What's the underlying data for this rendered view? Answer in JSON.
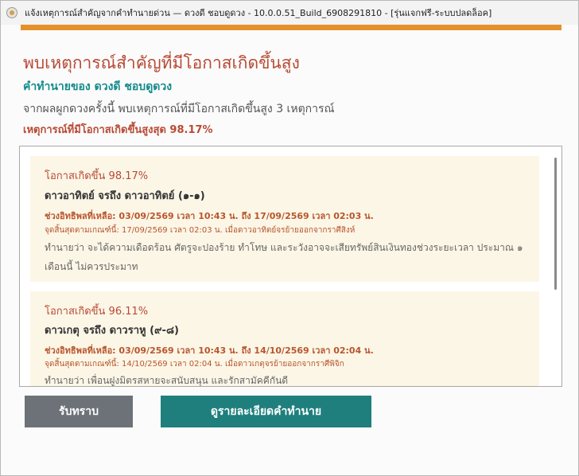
{
  "window": {
    "title": "แจ้งเหตุการณ์สำคัญจากคำทำนายด่วน — ดวงดี ชอบดูดวง - 10.0.0.51_Build_6908291810 - [รุ่นแจกฟรี-ระบบปลดล็อค]"
  },
  "header": {
    "heading": "พบเหตุการณ์สำคัญที่มีโอกาสเกิดขึ้นสูง",
    "subtitle": "คำทำนายของ ดวงดี ชอบดูดวง",
    "description": "จากผลผูกดวงครั้งนี้ พบเหตุการณ์ที่มีโอกาสเกิดขึ้นสูง 3 เหตุการณ์",
    "highest": "เหตุการณ์ที่มีโอกาสเกิดขึ้นสูงสุด 98.17%"
  },
  "events": [
    {
      "probability": "โอกาสเกิดขึ้น 98.17%",
      "planets": "ดาวอาทิตย์ จรถึง ดาวอาทิตย์ (๑-๑)",
      "period": "ช่วงอิทธิพลที่เหลือ: 03/09/2569 เวลา 10:43 น. ถึง 17/09/2569 เวลา 02:03 น.",
      "end_criteria": "จุดสิ้นสุดตามเกณฑ์นี้: 17/09/2569 เวลา 02:03 น. เมื่อดาวอาทิตย์จรย้ายออกจากราศีสิงห์",
      "prediction": "ทำนายว่า จะได้ความเดือดร้อน ศัตรูจะปองร้าย ทำโทษ และระวังอาจจะเสียทรัพย์สินเงินทองช่วงระยะเวลา ประมาณ ๑ เดือนนี้ ไม่ควรประมาท"
    },
    {
      "probability": "โอกาสเกิดขึ้น 96.11%",
      "planets": "ดาวเกตุ จรถึง ดาวราหู (๙-๘)",
      "period": "ช่วงอิทธิพลที่เหลือ: 03/09/2569 เวลา 10:43 น. ถึง 14/10/2569 เวลา 02:04 น.",
      "end_criteria": "จุดสิ้นสุดตามเกณฑ์นี้: 14/10/2569 เวลา 02:04 น. เมื่อดาวเกตุจรย้ายออกจากราศีพิจิก",
      "prediction": "ทำนายว่า เพื่อนฝูงมิตรสหายจะสนับสนุน และรักสามัคคีกันดี"
    }
  ],
  "buttons": {
    "acknowledge": "รับทราบ",
    "details": "ดูรายละเอียดคำทำนาย"
  },
  "colors": {
    "accent": "#e5912b",
    "heading": "#b84a34",
    "subtitle": "#138a8a",
    "card_bg": "#fcf6e7",
    "btn_ack": "#6c7277",
    "btn_detail": "#1f7f7d"
  }
}
